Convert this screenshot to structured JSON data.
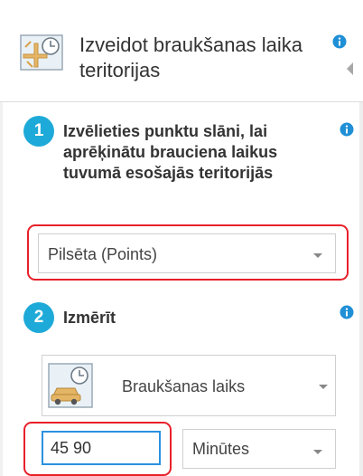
{
  "header": {
    "title": "Izveidot braukšanas laika teritorijas",
    "icon": "drive-time-areas-icon"
  },
  "step1": {
    "number": "1",
    "instruction": "Izvēlieties punktu slāni, lai aprēķinātu brauciena laikus tuvumā esošajās teritorijās",
    "layer_select_value": "Pilsēta (Points)"
  },
  "step2": {
    "number": "2",
    "title": "Izmērīt",
    "mode_select_value": "Braukšanas laiks",
    "mode_icon": "car-clock-icon",
    "time_input_value": "45 90",
    "unit_select_value": "Minūtes"
  },
  "colors": {
    "accent": "#1eaad8",
    "highlight": "#e8202a",
    "focus": "#2a91e0"
  }
}
